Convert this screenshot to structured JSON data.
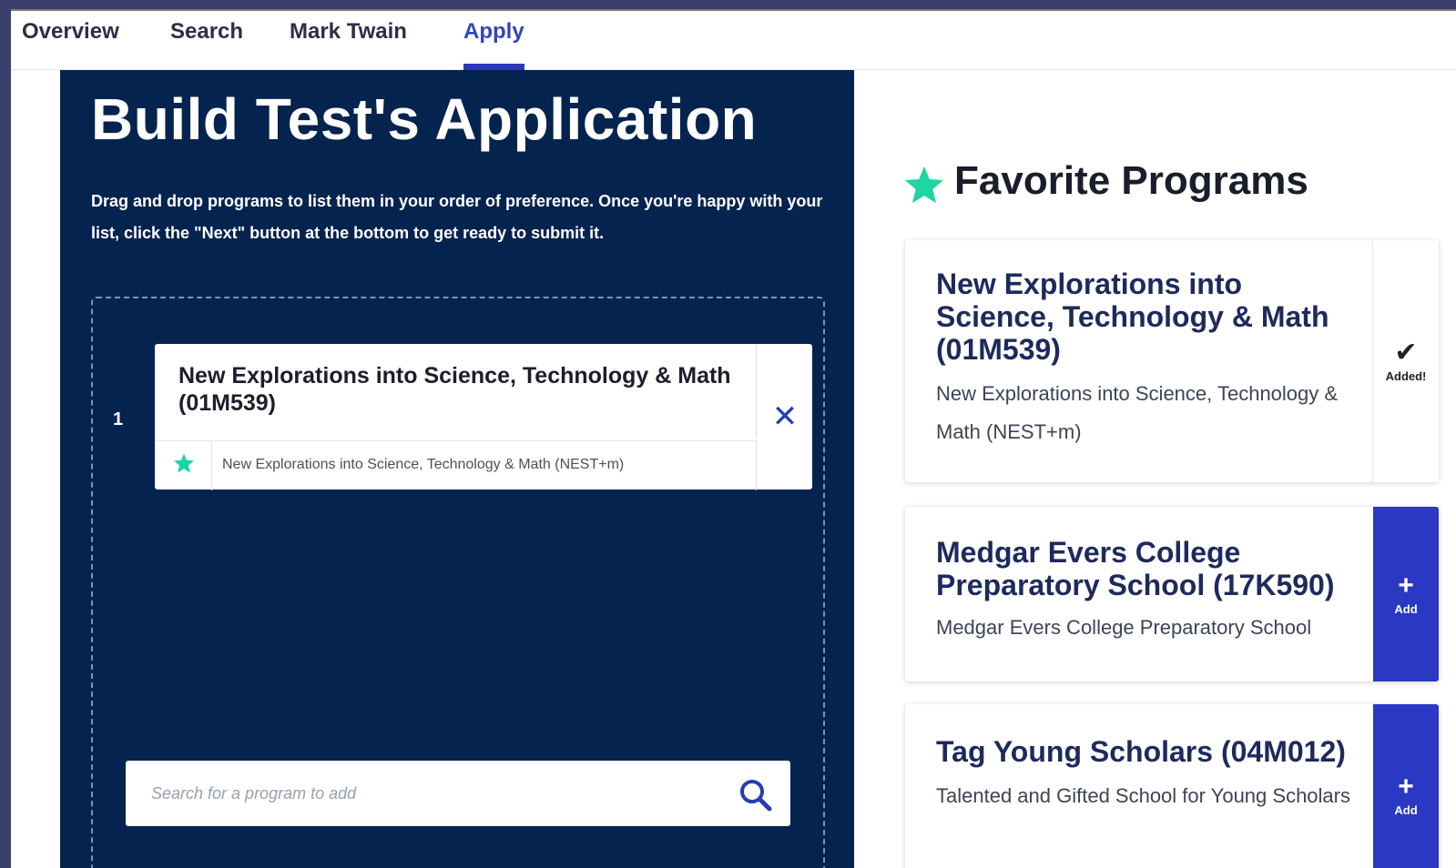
{
  "tabs": [
    {
      "label": "Overview",
      "active": false
    },
    {
      "label": "Search",
      "active": false
    },
    {
      "label": "Mark Twain",
      "active": false
    },
    {
      "label": "Apply",
      "active": true
    }
  ],
  "builder": {
    "title": "Build Test's Application",
    "description": "Drag and drop programs to list them in your order of preference. Once you're happy with your list, click the \"Next\" button at the bottom to get ready to submit it.",
    "selected": [
      {
        "rank": "1",
        "name": "New Explorations into Science, Technology & Math (01M539)",
        "school": "New Explorations into Science, Technology & Math (NEST+m)",
        "remove_icon": "✕"
      }
    ],
    "search": {
      "placeholder": "Search for a program to add",
      "icon": "search-icon"
    }
  },
  "favorites": {
    "title": "Favorite Programs",
    "programs": [
      {
        "name": "New Explorations into Science, Technology & Math (01M539)",
        "school": "New Explorations into Science, Technology & Math (NEST+m)",
        "action_icon": "✔",
        "action_label": "Added!"
      },
      {
        "name": "Medgar Evers College Preparatory School (17K590)",
        "school": "Medgar Evers College Preparatory School",
        "action_icon": "+",
        "action_label": "Add"
      },
      {
        "name": "Tag Young Scholars (04M012)",
        "school": "Talented and Gifted School for Young Scholars",
        "action_icon": "+",
        "action_label": "Add"
      }
    ]
  },
  "colors": {
    "navy": "#05234f",
    "accent_blue": "#2a38c4",
    "star_green": "#1ed5a4"
  }
}
